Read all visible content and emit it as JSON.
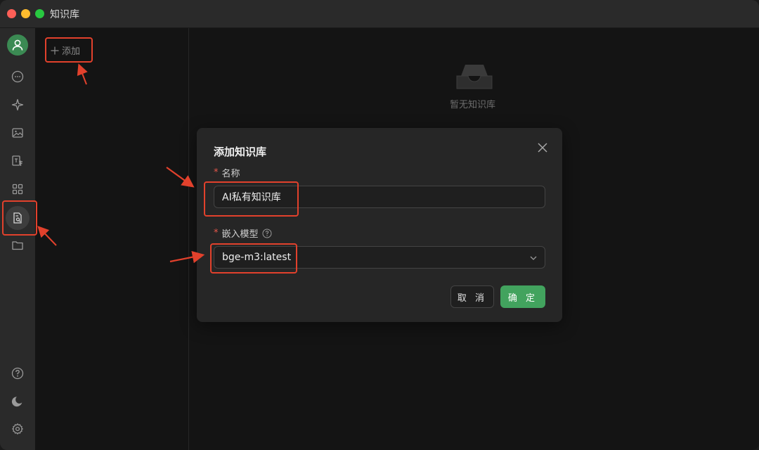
{
  "window": {
    "title": "知识库"
  },
  "left_panel": {
    "add_label": "添加"
  },
  "empty_state": {
    "text": "暂无知识库"
  },
  "dialog": {
    "title": "添加知识库",
    "name_label": "名称",
    "name_value": "AI私有知识库",
    "model_label": "嵌入模型",
    "model_value": "bge-m3:latest",
    "cancel_label": "取 消",
    "ok_label": "确 定",
    "required_mark": "*"
  },
  "sidebar": {
    "items": [
      "user-avatar",
      "chat-icon",
      "sparkle-icon",
      "image-icon",
      "translate-icon",
      "apps-icon",
      "knowledge-icon",
      "folder-icon",
      "help-icon",
      "theme-icon",
      "settings-icon"
    ],
    "active": "knowledge-icon"
  },
  "colors": {
    "accent": "#42a35e",
    "highlight": "#e2412c",
    "required": "#e5574b"
  }
}
